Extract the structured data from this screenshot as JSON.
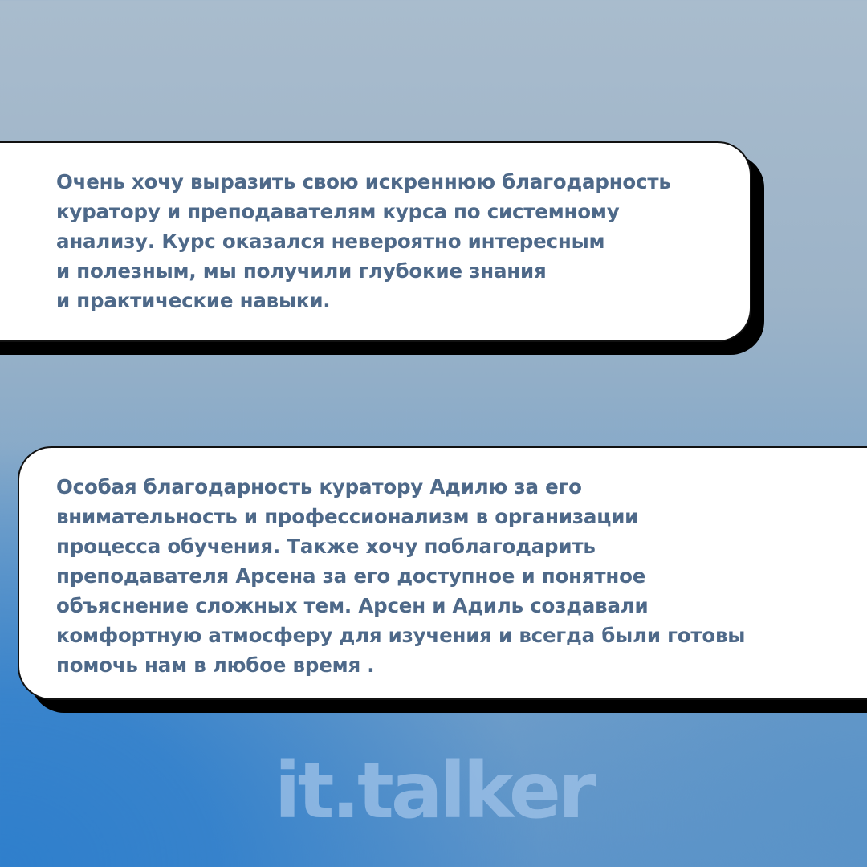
{
  "cards": [
    {
      "text": "Очень хочу выразить свою искреннюю благодарность\nкуратору и преподавателям курса по системному\nанализу. Курс оказался невероятно интересным\nи полезным, мы получили глубокие знания\nи практические навыки."
    },
    {
      "text": "Особая благодарность куратору Адилю за его\nвнимательность и профессионализм в организации\nпроцесса обучения. Также хочу поблагодарить\nпреподавателя Арсена за его доступное и понятное\nобъяснение сложных тем. Арсен и Адиль создавали\nкомфортную атмосферу для изучения и всегда были готовы\nпомочь нам в любое время ."
    }
  ],
  "logo": {
    "text": "it.talker"
  },
  "colors": {
    "text": "#4e6989",
    "card_background": "#ffffff",
    "card_shadow": "#000000",
    "logo": "#a0c3e8"
  }
}
